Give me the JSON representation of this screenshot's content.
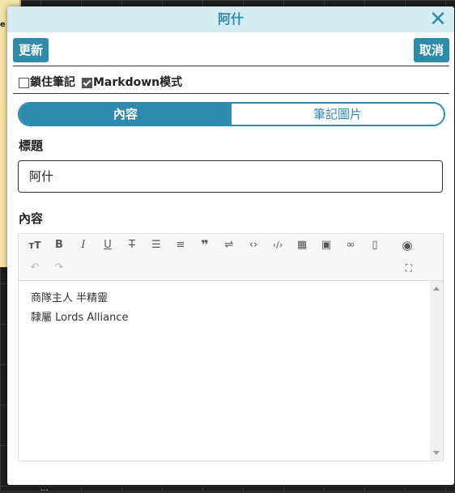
{
  "background": {
    "map_label": "e B",
    "bottom_text": "…"
  },
  "dialog": {
    "title": "阿什",
    "close_symbol": "✕"
  },
  "actions": {
    "update_label": "更新",
    "cancel_label": "取消"
  },
  "options": {
    "lock_note": {
      "label": "鎖住筆記",
      "checked": false
    },
    "markdown_mode": {
      "label": "Markdown模式",
      "checked": true
    }
  },
  "tabs": [
    {
      "label": "內容",
      "active": true
    },
    {
      "label": "筆記圖片",
      "active": false
    }
  ],
  "fields": {
    "title_label": "標題",
    "title_value": "阿什",
    "content_label": "內容"
  },
  "editor": {
    "toolbar_icons": [
      "heading-icon",
      "bold-icon",
      "italic-icon",
      "underline-icon",
      "strikethrough-icon",
      "unordered-list-icon",
      "ordered-list-icon",
      "quote-icon",
      "wrap-icon",
      "code-icon",
      "code-block-icon",
      "table-icon",
      "image-icon",
      "link-icon",
      "clear-icon",
      "preview-icon",
      "undo-icon",
      "redo-icon",
      "fullscreen-icon"
    ],
    "lines": [
      "商隊主人 半精靈",
      "隸屬 Lords Alliance"
    ]
  }
}
